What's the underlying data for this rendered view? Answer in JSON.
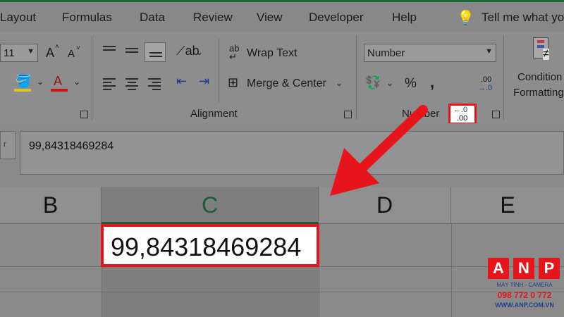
{
  "tabs": [
    "Layout",
    "Formulas",
    "Data",
    "Review",
    "View",
    "Developer",
    "Help"
  ],
  "tell_me": "Tell me what yo",
  "font": {
    "size": "11",
    "grow_label": "A",
    "shrink_label": "A"
  },
  "alignment": {
    "wrap_text": "Wrap Text",
    "merge_center": "Merge & Center",
    "group_label": "Alignment"
  },
  "number": {
    "format": "Number",
    "percent": "%",
    "comma": ",",
    "group_label": "Number",
    "increase_decimal_top": "←.0",
    "increase_decimal_bottom": ".00",
    "decrease_decimal_top": ".00",
    "decrease_decimal_bottom": "→.0"
  },
  "styles": {
    "conditional_line1": "Condition",
    "conditional_line2": "Formatting"
  },
  "formula_bar": {
    "name_box_partial": "r",
    "value": "99,84318469284"
  },
  "columns": [
    "B",
    "C",
    "D",
    "E"
  ],
  "cell_c1": {
    "value": "99,84318469284"
  },
  "logo": {
    "letters": [
      "A",
      "N",
      "P"
    ],
    "tagline": "MÁY TÍNH - CAMERA",
    "phone": "098 772 0 772",
    "site": "WWW.ANP.COM.VN"
  },
  "colors": {
    "highlight": "#e8141b",
    "excel_green": "#1f6b3a",
    "logo_red": "#e8141b",
    "logo_blue": "#1f3f8c"
  }
}
